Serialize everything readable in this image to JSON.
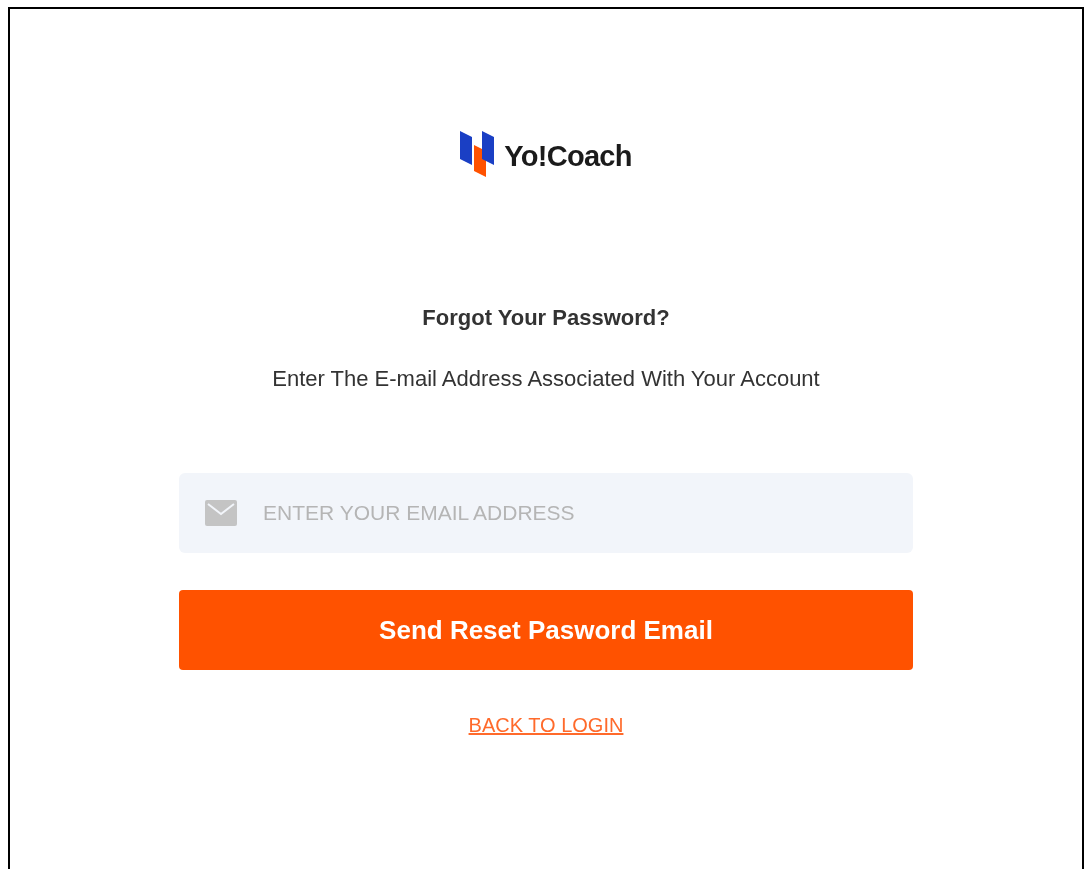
{
  "logo": {
    "text": "Yo!Coach"
  },
  "heading": "Forgot Your Password?",
  "subtitle": "Enter The E-mail Address Associated With Your Account",
  "email_field": {
    "placeholder": "ENTER YOUR EMAIL ADDRESS"
  },
  "submit_button": "Send Reset Pasword Email",
  "back_link": "BACK TO LOGIN"
}
